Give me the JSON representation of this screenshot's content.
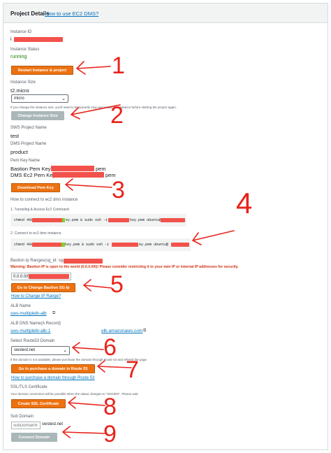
{
  "header": {
    "title": "Project Details",
    "help_link": "How to use EC2 DMS?"
  },
  "instance_id": {
    "label": "Instance ID",
    "value": "i"
  },
  "instance_status": {
    "label": "Instance Status",
    "value": "running"
  },
  "restart_button": "Restart Instance & project",
  "instance_size": {
    "label": "Instance Size",
    "value": "t2.micro",
    "selected": "micro",
    "help": "If you change the instance size, you'll need to temporarily stop and restart the instance before starting the project again.",
    "button": "Change Instance Size"
  },
  "sws_project": {
    "label": "SWS Project Name",
    "value": "test"
  },
  "dms_project": {
    "label": "DMS Project Name",
    "value": "product"
  },
  "pem": {
    "label": "Pem Key Name",
    "bastion_label": "Bastion Pem Key:",
    "bastion_suffix": "pem",
    "dms_label": "DMS Ec2 Pem Key:",
    "dms_suffix": "pem",
    "button": "Download Pem Key"
  },
  "connect": {
    "title": "How to connect to ec2 dms instance",
    "step1": "1. Tunneling & Access Ec2 Command",
    "cmd1_start": "chmod 400",
    "cmd1_mid": "ey.pem & sudo ssh -i ./",
    "cmd1_end": "key.pem ubuntu@",
    "step2": "2. Connect to ec2 dms instance",
    "cmd2_start": "chmod 400",
    "cmd2_mid": "key.pem & sudo ssh -i ./",
    "cmd2_end": "ey.pem ubuntu@"
  },
  "bastion_ip": {
    "label": "Bastion Ip Ranges(sg_id: sg-",
    "warning": "Warning: Bastion IP is open to the world (0.0.0.0/0)! Please consider restricting it to your own IP or internal IP addresses for security.",
    "value": "0.0.0.0/0",
    "button": "Go to Change Bastion SG Ip",
    "link": "How to Change IP Range?"
  },
  "alb": {
    "label": "ALB Name",
    "value": "sws-multiplelb-alb"
  },
  "alb_dns": {
    "label": "ALB DNS Name(A Record)",
    "value_start": "sws-multiplelb-alb-1",
    "value_end": "elb.amazonaws.com"
  },
  "route53": {
    "label": "Select Route53 Domain",
    "selected": "swstest.net",
    "help": "If the domain is not available, please purchase the domain through Route 53 and refresh the page.",
    "button": "Go to purchase a domain in Route 53",
    "link": "How to purchase a domain through Route 53"
  },
  "ssl": {
    "label": "SSL/TLS Certificate",
    "help": "Your domain connection will be possible when the status changes to \"ISSUED\". Please wait.",
    "button": "Create SSL Certificate"
  },
  "subdomain": {
    "label": "Sub Domain",
    "placeholder": "subDomainN",
    "suffix": "swstest.net",
    "button": "Connect Domain"
  },
  "annotations": [
    "1",
    "2",
    "3",
    "4",
    "5",
    "6",
    "7",
    "8",
    "9"
  ],
  "colors": {
    "accent": "#ec7211",
    "disabled": "#aab7b8",
    "link": "#0073bb",
    "success": "#1d8102",
    "annotation": "#e8231a",
    "redaction": "#f2524b"
  }
}
